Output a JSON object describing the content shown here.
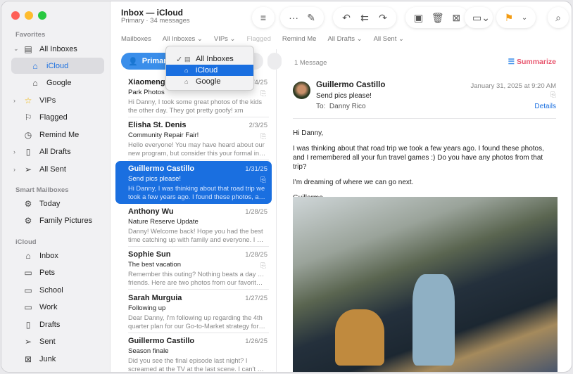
{
  "window": {
    "title": "Inbox — iCloud",
    "subtitle": "Primary · 34 messages"
  },
  "sidebar": {
    "favorites_header": "Favorites",
    "favorites": [
      {
        "label": "All Inboxes",
        "icon": "tray-stack-icon"
      },
      {
        "label": "iCloud",
        "icon": "tray-icon"
      },
      {
        "label": "Google",
        "icon": "tray-icon"
      },
      {
        "label": "VIPs",
        "icon": "star-icon"
      },
      {
        "label": "Flagged",
        "icon": "flag-icon"
      },
      {
        "label": "Remind Me",
        "icon": "clock-icon"
      },
      {
        "label": "All Drafts",
        "icon": "document-icon"
      },
      {
        "label": "All Sent",
        "icon": "paperplane-icon"
      }
    ],
    "smart_header": "Smart Mailboxes",
    "smart": [
      {
        "label": "Today"
      },
      {
        "label": "Family Pictures"
      }
    ],
    "icloud_header": "iCloud",
    "icloud": [
      {
        "label": "Inbox"
      },
      {
        "label": "Pets"
      },
      {
        "label": "School"
      },
      {
        "label": "Work"
      },
      {
        "label": "Drafts"
      },
      {
        "label": "Sent"
      },
      {
        "label": "Junk"
      }
    ]
  },
  "favbar": {
    "mailboxes": "Mailboxes",
    "all_inboxes": "All Inboxes ⌄",
    "vips": "VIPs ⌄",
    "flagged": "Flagged",
    "remind": "Remind Me",
    "drafts": "All Drafts ⌄",
    "sent": "All Sent ⌄"
  },
  "dropdown": {
    "items": [
      "All Inboxes",
      "iCloud",
      "Google"
    ],
    "checked": "All Inboxes",
    "selected": "iCloud"
  },
  "list": {
    "primary_label": "Primary",
    "messages": [
      {
        "from": "Xiaomeng Zhong",
        "date": "2/4/25",
        "subject": "Park Photos",
        "preview1": "Hi Danny, I took some great photos of the kids",
        "preview2": "the other day. They got pretty goofy! xm"
      },
      {
        "from": "Elisha St. Denis",
        "date": "2/3/25",
        "subject": "Community Repair Fair!",
        "preview1": "Hello everyone! You may have heard about our",
        "preview2": "new program, but consider this your formal invit..."
      },
      {
        "from": "Guillermo Castillo",
        "date": "1/31/25",
        "subject": "Send pics please!",
        "preview1": "Hi Danny, I was thinking about that road trip we",
        "preview2": "took a few years ago. I found these photos, and..."
      },
      {
        "from": "Anthony Wu",
        "date": "1/28/25",
        "subject": "Nature Reserve Update",
        "preview1": "Danny! Welcome back! Hope you had the best",
        "preview2": "time catching up with family and everyone. I kn..."
      },
      {
        "from": "Sophie Sun",
        "date": "1/28/25",
        "subject": "The best vacation",
        "preview1": "Remember this outing? Nothing beats a day with",
        "preview2": "friends. Here are two photos from our favorite s..."
      },
      {
        "from": "Sarah Murguia",
        "date": "1/27/25",
        "subject": "Following up",
        "preview1": "Dear Danny, I'm following up regarding the 4th",
        "preview2": "quarter plan for our Go-to-Market strategy for t..."
      },
      {
        "from": "Guillermo Castillo",
        "date": "1/26/25",
        "subject": "Season finale",
        "preview1": "Did you see the final episode last night? I",
        "preview2": "screamed at the TV at the last scene. I can't bel..."
      }
    ]
  },
  "detail": {
    "count": "1 Message",
    "summarize": "Summarize",
    "from": "Guillermo Castillo",
    "date": "January 31, 2025 at 9:20 AM",
    "subject": "Send pics please!",
    "to_label": "To:",
    "to": "Danny Rico",
    "details": "Details",
    "body": [
      "Hi Danny,",
      "I was thinking about that road trip we took a few years ago. I found these photos, and I remembered all your fun travel games :) Do you have any photos from that trip?",
      "I'm dreaming of where we can go next.",
      "Guillermo"
    ]
  },
  "colors": {
    "accent": "#1a6fe0",
    "flag": "#f39b12"
  }
}
